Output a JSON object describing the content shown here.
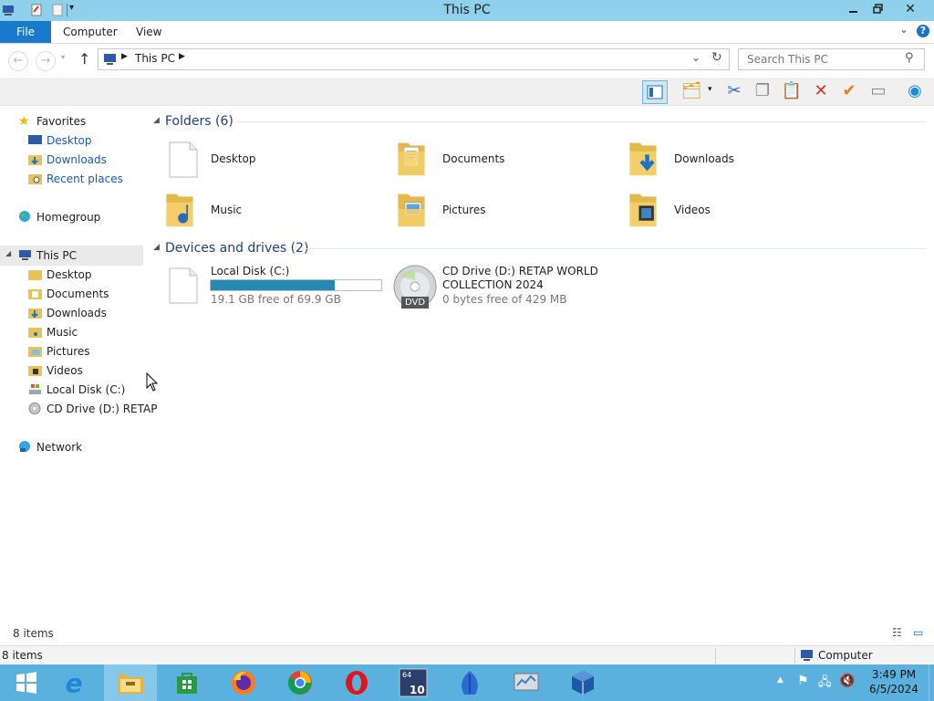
{
  "window": {
    "title": "This PC",
    "controls": [
      "minimize",
      "restore",
      "close"
    ]
  },
  "ribbon": {
    "file_tab": "File",
    "tabs": [
      "Computer",
      "View"
    ]
  },
  "address": {
    "path": "This PC",
    "search_placeholder": "Search This PC"
  },
  "nav": {
    "favorites": {
      "label": "Favorites",
      "items": [
        "Desktop",
        "Downloads",
        "Recent places"
      ]
    },
    "homegroup": "Homegroup",
    "this_pc": {
      "label": "This PC",
      "items": [
        "Desktop",
        "Documents",
        "Downloads",
        "Music",
        "Pictures",
        "Videos",
        "Local Disk (C:)",
        "CD Drive (D:) RETAP"
      ]
    },
    "network": "Network"
  },
  "content": {
    "folders_header": "Folders (6)",
    "folders": [
      "Desktop",
      "Documents",
      "Downloads",
      "Music",
      "Pictures",
      "Videos"
    ],
    "drives_header": "Devices and drives (2)",
    "drives": [
      {
        "name": "Local Disk (C:)",
        "free": "19.1 GB free of 69.9 GB",
        "used_fraction": 0.727
      },
      {
        "name_line1": "CD Drive (D:) RETAP WORLD",
        "name_line2": "COLLECTION 2024",
        "free": "0 bytes free of 429 MB",
        "badge": "DVD"
      }
    ]
  },
  "status": {
    "items_count": "8 items",
    "bar_items": "8 items",
    "location": "Computer"
  },
  "taskbar": {
    "time": "3:49 PM",
    "date": "6/5/2024",
    "apps": [
      "start",
      "internet-explorer",
      "file-explorer",
      "store",
      "firefox",
      "chrome",
      "opera",
      "win10-badge",
      "feather",
      "network-monitor",
      "virtualbox"
    ]
  },
  "colors": {
    "titlebar": "#8fd0ea",
    "file_tab": "#1979ca",
    "taskbar": "#5ab1de",
    "drive_bar": "#2689b4",
    "section_header": "#1e3d8f",
    "link_blue": "#1a56c6"
  }
}
